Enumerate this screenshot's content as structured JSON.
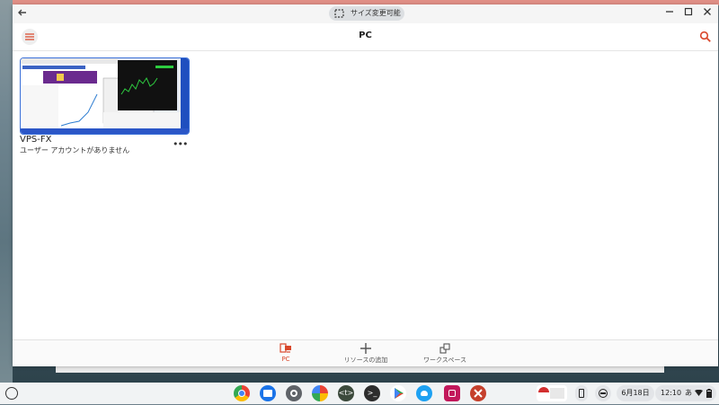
{
  "window": {
    "resize_label": "サイズ変更可能"
  },
  "appbar": {
    "title": "PC"
  },
  "card": {
    "name": "VPS-FX",
    "subtitle": "ユーザー アカウントがありません",
    "more": "•••"
  },
  "bottomnav": {
    "items": [
      {
        "label": "PC",
        "icon": "desktop-icon",
        "active": true
      },
      {
        "label": "リソースの追加",
        "icon": "plus-icon",
        "active": false
      },
      {
        "label": "ワークスペース",
        "icon": "workspace-icon",
        "active": false
      }
    ]
  },
  "shelf": {
    "apps": [
      "chrome-icon",
      "files-icon",
      "settings-icon",
      "photos-icon",
      "code-icon",
      "terminal-icon",
      "play-store-icon",
      "bird-app-icon",
      "camera-app-icon",
      "remote-desktop-icon"
    ],
    "date": "6月18日",
    "time": "12:10",
    "ime": "あ"
  },
  "colors": {
    "accent": "#d9472b",
    "card_border": "#3a6fd8"
  }
}
